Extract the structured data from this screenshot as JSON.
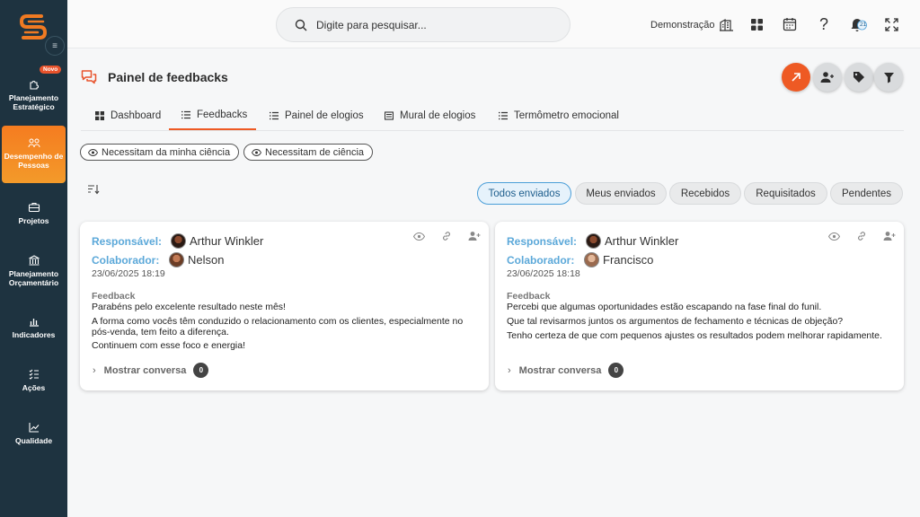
{
  "sidebar": {
    "badge_new": "Novo",
    "items": [
      {
        "label": "Planejamento Estratégico",
        "icon": "puzzle-icon"
      },
      {
        "label": "Desempenho de Pessoas",
        "icon": "people-icon",
        "active": true
      },
      {
        "label": "Projetos",
        "icon": "briefcase-icon"
      },
      {
        "label": "Planejamento Orçamentário",
        "icon": "bank-icon"
      },
      {
        "label": "Indicadores",
        "icon": "bar-chart-icon"
      },
      {
        "label": "Ações",
        "icon": "checklist-icon"
      },
      {
        "label": "Qualidade",
        "icon": "trend-icon"
      }
    ]
  },
  "topbar": {
    "search_placeholder": "Digite para pesquisar...",
    "company_label": "Demonstração",
    "notification_count": "21"
  },
  "page": {
    "title": "Painel de feedbacks"
  },
  "tabs": [
    {
      "label": "Dashboard",
      "icon": "grid-icon"
    },
    {
      "label": "Feedbacks",
      "icon": "list-icon",
      "active": true
    },
    {
      "label": "Painel de elogios",
      "icon": "list-icon"
    },
    {
      "label": "Mural de elogios",
      "icon": "board-icon"
    },
    {
      "label": "Termômetro emocional",
      "icon": "list-icon"
    }
  ],
  "chips": [
    "Necessitam da minha ciência",
    "Necessitam de ciência"
  ],
  "filters": [
    "Todos enviados",
    "Meus enviados",
    "Recebidos",
    "Requisitados",
    "Pendentes"
  ],
  "active_filter": "Todos enviados",
  "cards": [
    {
      "responsavel_label": "Responsável:",
      "responsavel": "Arthur Winkler",
      "colaborador_label": "Colaborador:",
      "colaborador": "Nelson",
      "date": "23/06/2025 18:19",
      "feedback_label": "Feedback",
      "lines": [
        "Parabéns pelo excelente resultado neste mês!",
        "A forma como vocês têm conduzido o relacionamento com os clientes, especialmente no pós-venda, tem feito a diferença.",
        "Continuem com esse foco e energia!"
      ],
      "show_conversation": "Mostrar conversa",
      "conversation_count": "0"
    },
    {
      "responsavel_label": "Responsável:",
      "responsavel": "Arthur Winkler",
      "colaborador_label": "Colaborador:",
      "colaborador": "Francisco",
      "date": "23/06/2025 18:18",
      "feedback_label": "Feedback",
      "lines": [
        "Percebi que algumas oportunidades estão escapando na fase final do funil.",
        "Que tal revisarmos juntos os argumentos de fechamento e técnicas de objeção?",
        "Tenho certeza de que com pequenos ajustes os resultados podem melhorar rapidamente."
      ],
      "show_conversation": "Mostrar conversa",
      "conversation_count": "0"
    }
  ],
  "colors": {
    "sidebar_bg": "#1e3340",
    "accent_orange": "#ee5a24",
    "label_blue": "#5ba8d9"
  }
}
